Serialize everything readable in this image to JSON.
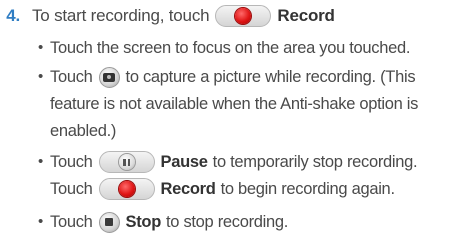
{
  "step": {
    "number": "4.",
    "text_before": "To start recording, touch",
    "button_label": "Record"
  },
  "bullets": [
    {
      "lines": [
        "Touch the screen to focus on the area you touched."
      ]
    },
    {
      "prefix": "Touch",
      "icon": "camera-icon",
      "lines": [
        "to capture a picture while recording. (This",
        "feature is not available when the Anti-shake option is",
        "enabled.)"
      ]
    },
    {
      "prefix": "Touch",
      "icon": "pause-icon",
      "bold": "Pause",
      "text": "to temporarily stop recording.",
      "line2_prefix": "Touch",
      "line2_icon": "record-icon",
      "line2_bold": "Record",
      "line2_text": "to begin recording again."
    },
    {
      "prefix": "Touch",
      "icon": "stop-icon",
      "bold": "Stop",
      "text": "to stop recording."
    }
  ],
  "colors": {
    "step_number": "#2f7dc3",
    "record_red": "#e01616",
    "text": "#4a4a4a"
  }
}
